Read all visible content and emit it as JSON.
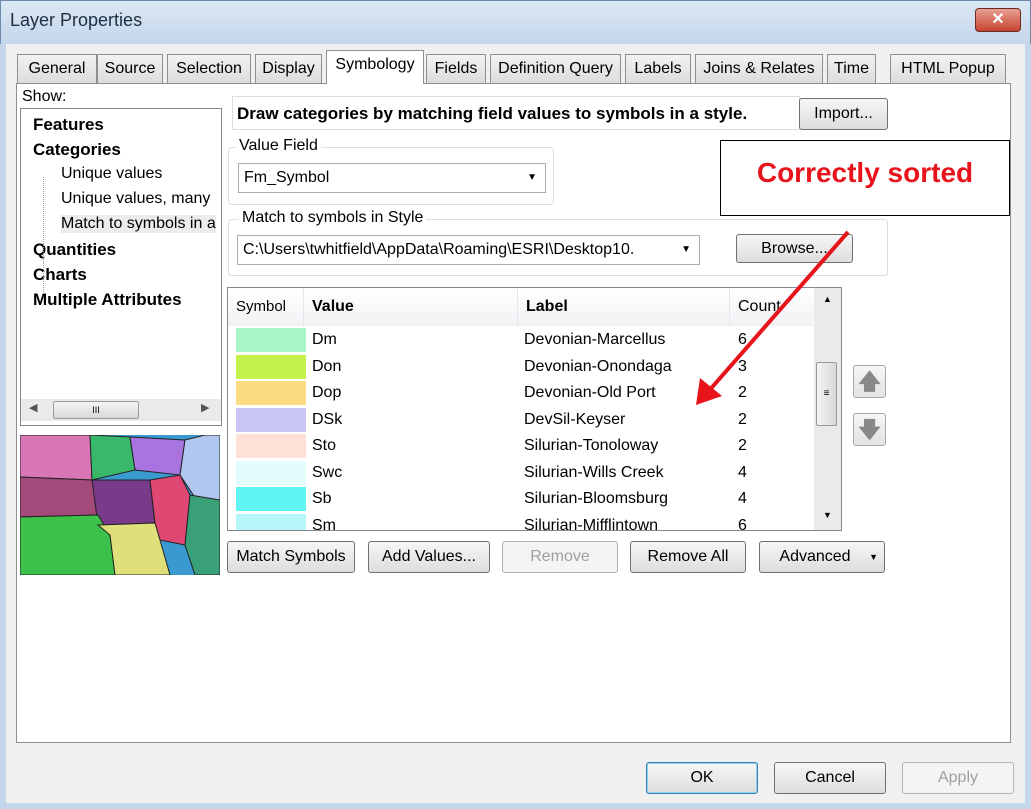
{
  "window": {
    "title": "Layer Properties",
    "close_icon": "close-icon"
  },
  "tabs": [
    "General",
    "Source",
    "Selection",
    "Display",
    "Symbology",
    "Fields",
    "Definition Query",
    "Labels",
    "Joins & Relates",
    "Time",
    "HTML Popup"
  ],
  "active_tab": "Symbology",
  "show": {
    "label": "Show:",
    "items": [
      {
        "label": "Features",
        "bold": true
      },
      {
        "label": "Categories",
        "bold": true
      },
      {
        "label": "Unique values",
        "bold": false
      },
      {
        "label": "Unique values, many",
        "bold": false
      },
      {
        "label": "Match to symbols in a",
        "bold": false,
        "selected": true
      },
      {
        "label": "Quantities",
        "bold": true
      },
      {
        "label": "Charts",
        "bold": true
      },
      {
        "label": "Multiple Attributes",
        "bold": true
      }
    ],
    "hscroll_thumb": "III"
  },
  "description": "Draw categories by matching field values to symbols in a style.",
  "import_button": "Import...",
  "value_field": {
    "label": "Value Field",
    "value": "Fm_Symbol"
  },
  "style": {
    "label": "Match to symbols in Style",
    "value": "C:\\Users\\twhitfield\\AppData\\Roaming\\ESRI\\Desktop10.",
    "browse_button": "Browse..."
  },
  "table": {
    "headers": [
      "Symbol",
      "Value",
      "Label",
      "Count"
    ],
    "rows": [
      {
        "color": "#a8f5c8",
        "value": "Dm",
        "label": "Devonian-Marcellus",
        "count": "6"
      },
      {
        "color": "#c4f24a",
        "value": "Don",
        "label": "Devonian-Onondaga",
        "count": "3"
      },
      {
        "color": "#fcdc82",
        "value": "Dop",
        "label": "Devonian-Old Port",
        "count": "2"
      },
      {
        "color": "#c8c4f4",
        "value": "DSk",
        "label": "DevSil-Keyser",
        "count": "2"
      },
      {
        "color": "#fde0d6",
        "value": "Sto",
        "label": "Silurian-Tonoloway",
        "count": "2"
      },
      {
        "color": "#e2fdfc",
        "value": "Swc",
        "label": "Silurian-Wills Creek",
        "count": "4"
      },
      {
        "color": "#5ef5f2",
        "value": "Sb",
        "label": "Silurian-Bloomsburg",
        "count": "4"
      },
      {
        "color": "#b6f5f8",
        "value": "Sm",
        "label": "Silurian-Mifflintown",
        "count": "6"
      }
    ]
  },
  "buttons": {
    "match_symbols": "Match Symbols",
    "add_values": "Add Values...",
    "remove": "Remove",
    "remove_all": "Remove All",
    "advanced": "Advanced"
  },
  "annotation": {
    "text": "Correctly sorted",
    "color": "#e8141b"
  },
  "footer": {
    "ok": "OK",
    "cancel": "Cancel",
    "apply": "Apply"
  }
}
